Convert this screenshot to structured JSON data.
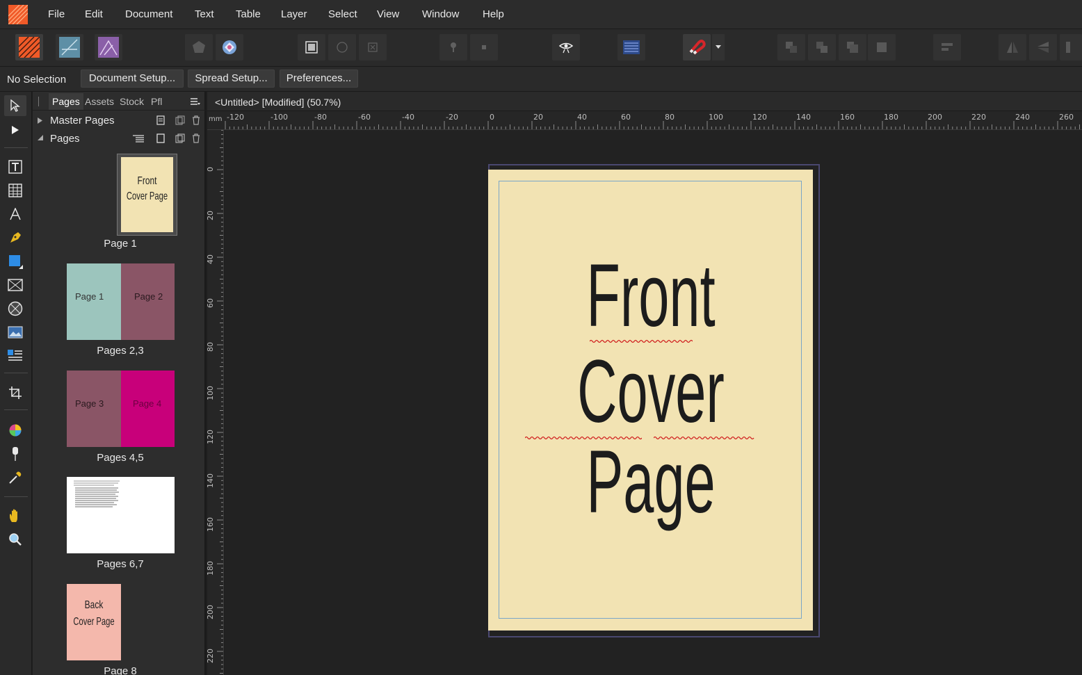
{
  "menu": {
    "items": [
      "File",
      "Edit",
      "Document",
      "Text",
      "Table",
      "Layer",
      "Select",
      "View",
      "Window",
      "Help"
    ]
  },
  "context_bar": {
    "status": "No Selection",
    "buttons": [
      "Document Setup...",
      "Spread Setup...",
      "Preferences..."
    ]
  },
  "panel": {
    "tabs": [
      "Pages",
      "Assets",
      "Stock",
      "Pfl"
    ],
    "active_tab": "Pages",
    "sections": {
      "master_pages": "Master Pages",
      "pages": "Pages"
    },
    "thumbnails": [
      {
        "caption": "Page 1",
        "text": [
          "Front",
          "Cover Page"
        ],
        "color": "#f2e3b3"
      },
      {
        "caption": "Pages 2,3",
        "left_label": "Page 1",
        "right_label": "Page 2",
        "left_color": "#9cc5bd",
        "right_color": "#8a5566"
      },
      {
        "caption": "Pages 4,5",
        "left_label": "Page 3",
        "right_label": "Page 4",
        "left_color": "#8a5566",
        "right_color": "#c8007a"
      },
      {
        "caption": "Pages 6,7",
        "left_color": "#ffffff",
        "right_color": "#ffffff"
      },
      {
        "caption": "Page 8",
        "text": [
          "Back",
          "Cover Page"
        ],
        "color": "#f4b8ac"
      }
    ]
  },
  "document": {
    "title": "<Untitled> [Modified] (50.7%)",
    "ruler_unit": "mm",
    "h_ruler_labels": [
      "-120",
      "-100",
      "-80",
      "-60",
      "-40",
      "-20",
      "0",
      "20",
      "40",
      "60",
      "80",
      "100",
      "120",
      "140",
      "160",
      "180",
      "200",
      "220",
      "240",
      "260"
    ],
    "v_ruler_labels": [
      "0",
      "20",
      "40",
      "60",
      "80",
      "100",
      "120",
      "140",
      "160",
      "180",
      "200",
      "220"
    ],
    "page_color": "#f2e3b3",
    "page_text": {
      "line1": "Front",
      "line2": "Cover Page"
    }
  },
  "colors": {
    "accent": "#f05a28",
    "margin_guide": "#7aa6c8",
    "bleed": "#4a4870"
  }
}
